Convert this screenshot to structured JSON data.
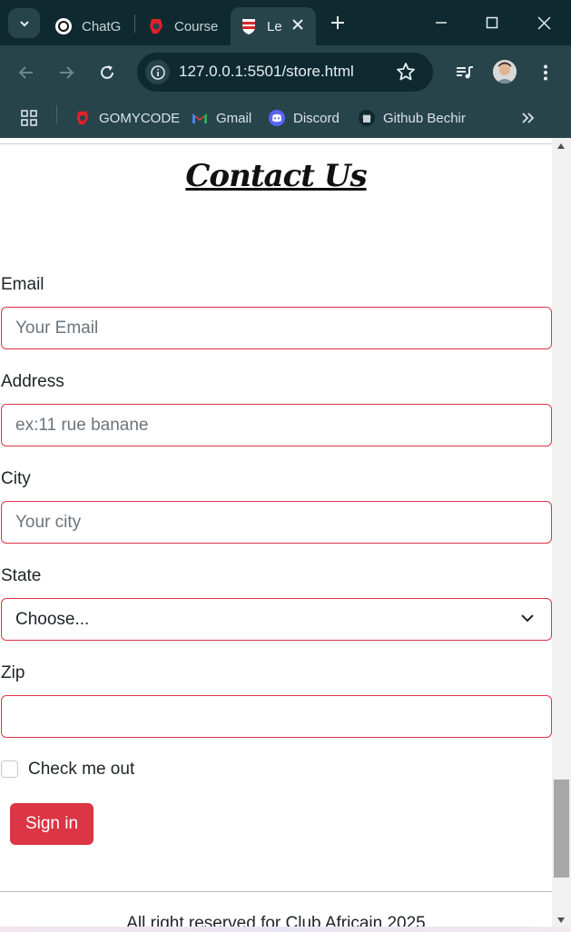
{
  "browser": {
    "tabs": [
      {
        "title": "ChatG",
        "icon": "chatgpt-icon"
      },
      {
        "title": "Course",
        "icon": "gomycode-icon"
      },
      {
        "title": "Le",
        "icon": "club-africain-icon",
        "active": true
      }
    ],
    "address": "127.0.0.1:5501/store.html",
    "bookmarks": [
      {
        "label": "GOMYCODE",
        "icon": "gomycode-icon"
      },
      {
        "label": "Gmail",
        "icon": "gmail-icon"
      },
      {
        "label": "Discord",
        "icon": "discord-icon"
      },
      {
        "label": "Github Bechir",
        "icon": "github-icon"
      }
    ],
    "colors": {
      "frame": "#0e2a30",
      "toolbar": "#27444b"
    }
  },
  "page": {
    "title": "Contact Us",
    "form": {
      "email": {
        "label": "Email",
        "placeholder": "Your Email",
        "value": ""
      },
      "address": {
        "label": "Address",
        "placeholder": "ex:11 rue banane",
        "value": ""
      },
      "city": {
        "label": "City",
        "placeholder": "Your city",
        "value": ""
      },
      "state": {
        "label": "State",
        "selected": "Choose..."
      },
      "zip": {
        "label": "Zip",
        "placeholder": "",
        "value": ""
      },
      "checkbox": {
        "label": "Check me out",
        "checked": false
      },
      "submit": "Sign in"
    },
    "footer": "All right reserved for Club Africain 2025",
    "colors": {
      "accent": "#dc3545"
    }
  }
}
